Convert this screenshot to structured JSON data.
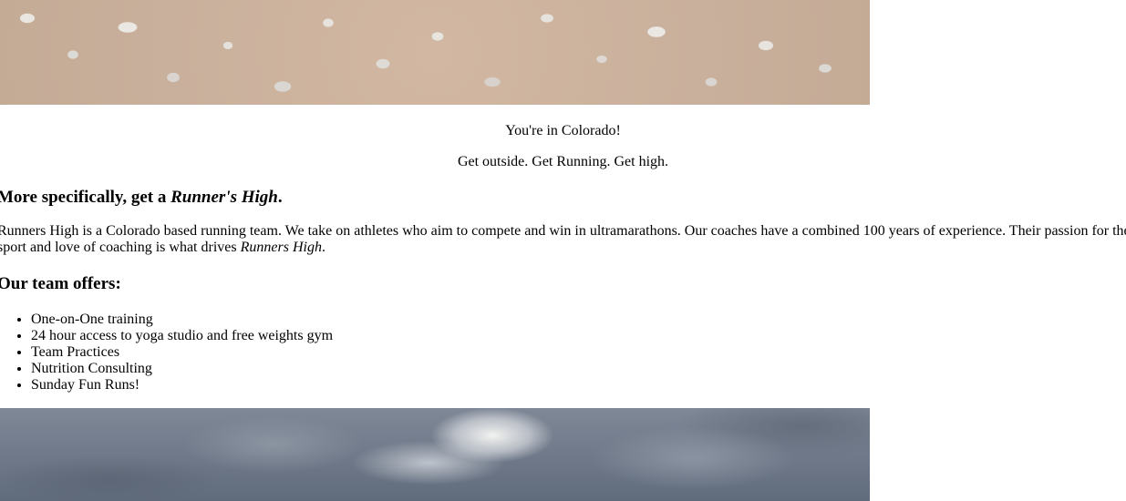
{
  "tagline": {
    "line1": "You're in Colorado!",
    "line2": "Get outside. Get Running. Get high."
  },
  "heading1": {
    "prefix": "More specifically, get a ",
    "emphasis": "Runner's High",
    "suffix": "."
  },
  "intro": {
    "text": "Runners High is a Colorado based running team. We take on athletes who aim to compete and win in ultramarathons. Our coaches have a combined 100 years of experience. Their passion for the sport and love of coaching is what drives ",
    "emphasis": "Runners High",
    "suffix": "."
  },
  "heading2": "Our team offers:",
  "offers": [
    "One-on-One training",
    "24 hour access to yoga studio and free weights gym",
    "Team Practices",
    "Nutrition Consulting",
    "Sunday Fun Runs!"
  ]
}
